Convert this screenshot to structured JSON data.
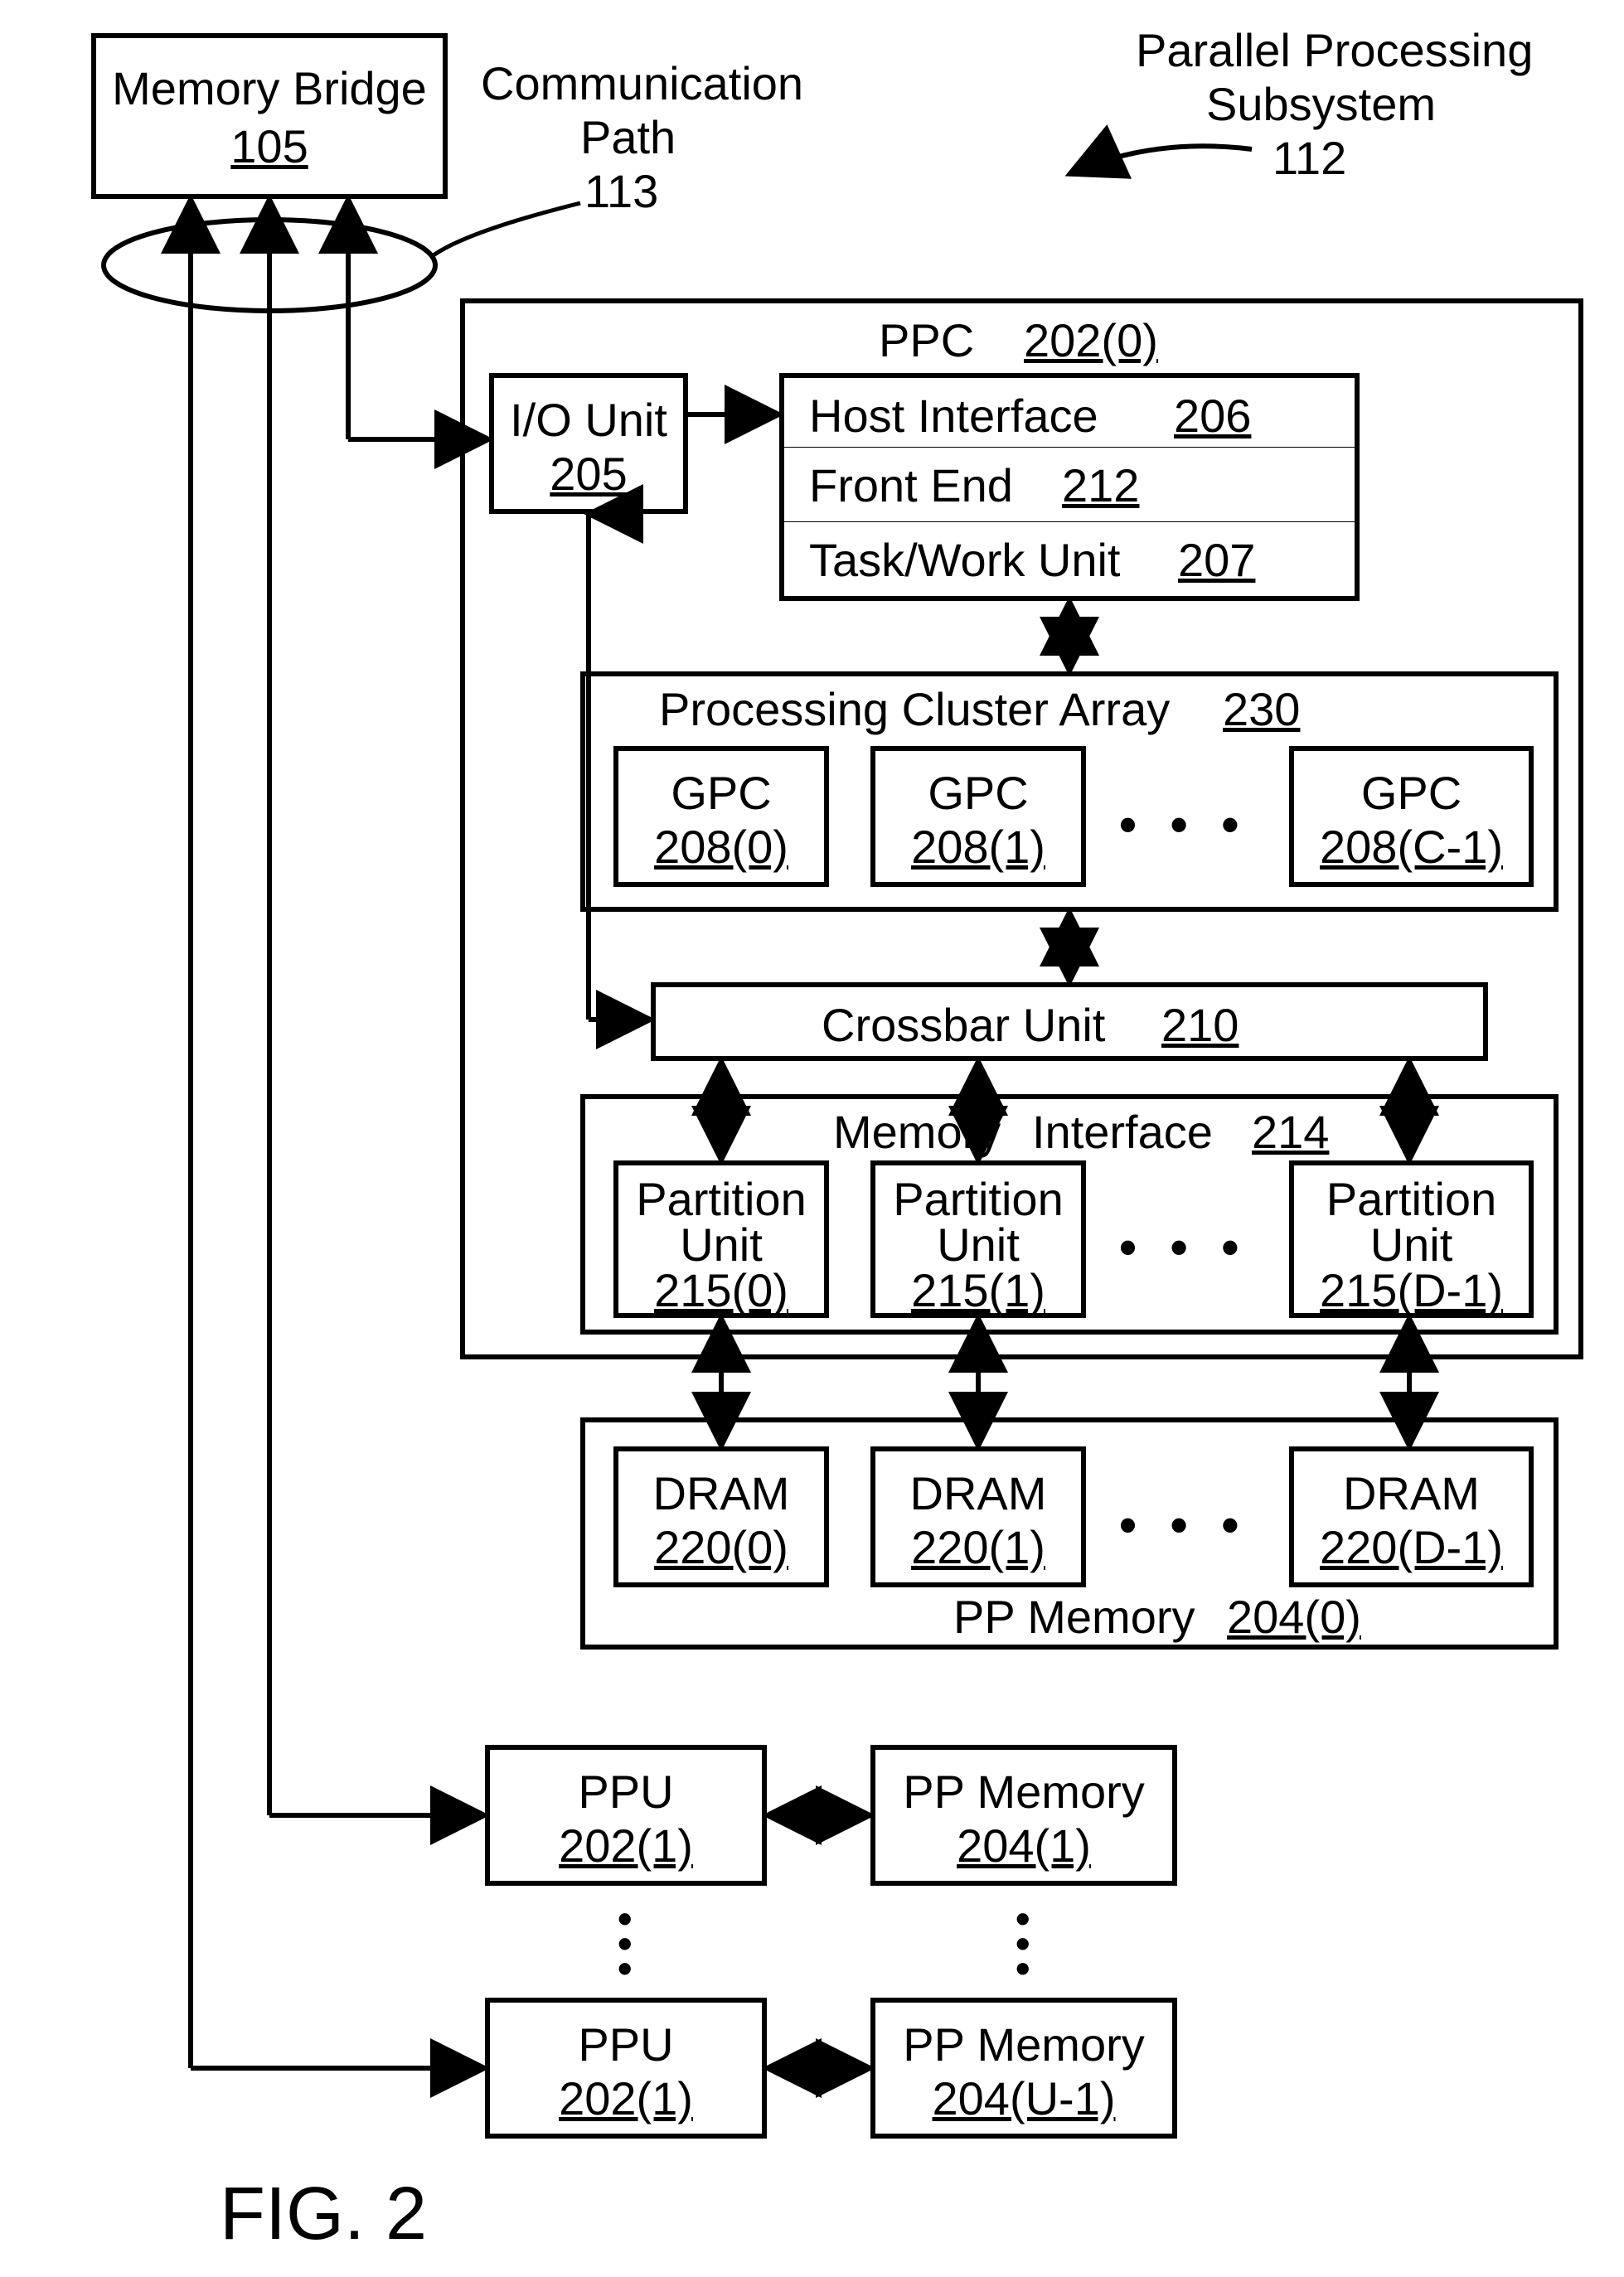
{
  "top": {
    "memory_bridge": "Memory Bridge",
    "memory_bridge_ref": "105",
    "comm_path": "Communication",
    "comm_path2": "Path",
    "comm_path_ref": "113",
    "pps": "Parallel Processing",
    "pps2": "Subsystem",
    "pps_ref": "112"
  },
  "ppc": {
    "title": "PPC",
    "title_ref": "202(0)",
    "io_unit": "I/O Unit",
    "io_unit_ref": "205",
    "host_if": "Host Interface",
    "host_if_ref": "206",
    "front_end": "Front End",
    "front_end_ref": "212",
    "task_unit": "Task/Work Unit",
    "task_unit_ref": "207",
    "pca": "Processing Cluster Array",
    "pca_ref": "230",
    "gpc": "GPC",
    "gpc0_ref": "208(0)",
    "gpc1_ref": "208(1)",
    "gpcC_ref": "208(C-1)",
    "crossbar": "Crossbar Unit",
    "crossbar_ref": "210",
    "mem_if": "Memory",
    "mem_if2": "Interface",
    "mem_if_ref": "214",
    "part_unit": "Partition",
    "part_unit2": "Unit",
    "part0_ref": "215(0)",
    "part1_ref": "215(1)",
    "partD_ref": "215(D-1)"
  },
  "ppmem": {
    "dram": "DRAM",
    "dram0_ref": "220(0)",
    "dram1_ref": "220(1)",
    "dramD_ref": "220(D-1)",
    "title": "PP Memory",
    "title_ref": "204(0)"
  },
  "lower": {
    "ppu": "PPU",
    "ppu1_ref": "202(1)",
    "ppuU_ref": "202(1)",
    "ppmem1": "PP Memory",
    "ppmem1_ref": "204(1)",
    "ppmemU": "PP Memory",
    "ppmemU_ref": "204(U-1)"
  },
  "figure": "FIG. 2",
  "ellipsis": "• • •"
}
